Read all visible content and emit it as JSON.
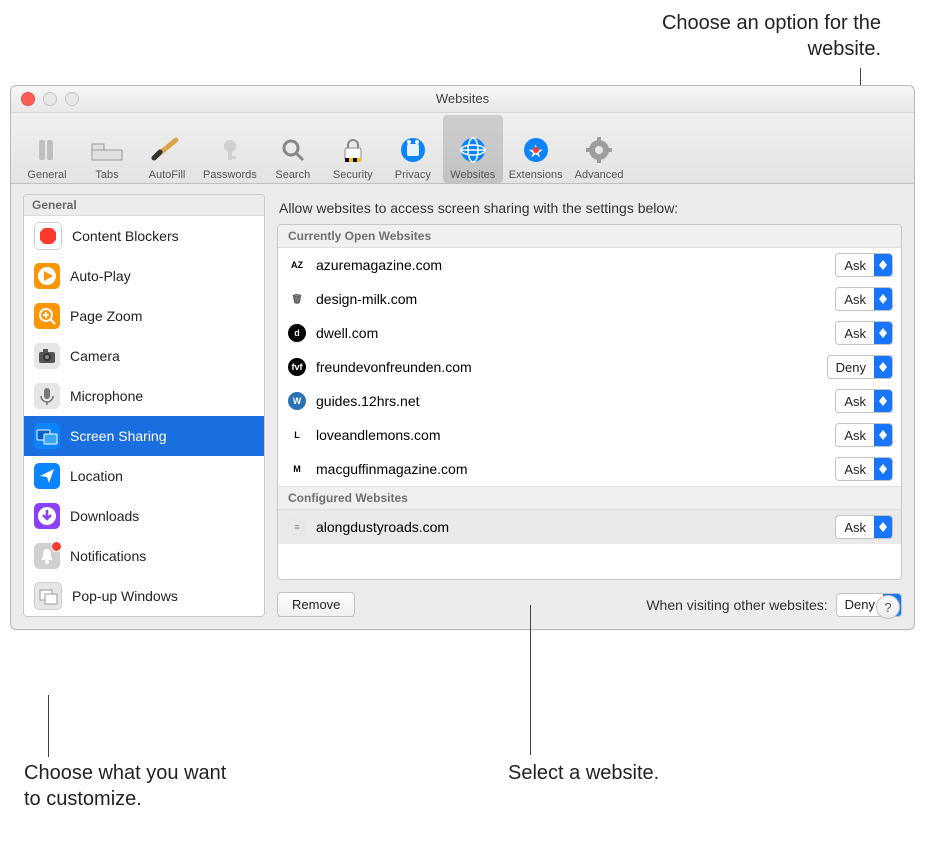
{
  "callouts": {
    "top": "Choose an option for the website.",
    "bottomLeft": "Choose what you want to customize.",
    "bottomRight": "Select a website."
  },
  "window": {
    "title": "Websites"
  },
  "toolbar": {
    "items": [
      {
        "label": "General"
      },
      {
        "label": "Tabs"
      },
      {
        "label": "AutoFill"
      },
      {
        "label": "Passwords"
      },
      {
        "label": "Search"
      },
      {
        "label": "Security"
      },
      {
        "label": "Privacy"
      },
      {
        "label": "Websites"
      },
      {
        "label": "Extensions"
      },
      {
        "label": "Advanced"
      }
    ],
    "selected": "Websites"
  },
  "sidebar": {
    "header": "General",
    "items": [
      {
        "label": "Content Blockers",
        "icon": "stop",
        "bg": "#ffffff",
        "badge": false
      },
      {
        "label": "Auto-Play",
        "icon": "play",
        "bg": "#ff9500",
        "badge": false
      },
      {
        "label": "Page Zoom",
        "icon": "zoom",
        "bg": "#ff9500",
        "badge": false
      },
      {
        "label": "Camera",
        "icon": "camera",
        "bg": "#7a7a7a",
        "badge": false
      },
      {
        "label": "Microphone",
        "icon": "mic",
        "bg": "#c9c9c9",
        "badge": false
      },
      {
        "label": "Screen Sharing",
        "icon": "screens",
        "bg": "#0a84ff",
        "badge": false
      },
      {
        "label": "Location",
        "icon": "arrow",
        "bg": "#0a84ff",
        "badge": false
      },
      {
        "label": "Downloads",
        "icon": "download",
        "bg": "#8d3fff",
        "badge": false
      },
      {
        "label": "Notifications",
        "icon": "bell",
        "bg": "#d0d0d0",
        "badge": true
      },
      {
        "label": "Pop-up Windows",
        "icon": "popup",
        "bg": "#ffffff",
        "badge": false
      }
    ],
    "selected": "Screen Sharing"
  },
  "main": {
    "heading": "Allow websites to access screen sharing with the settings below:",
    "sections": {
      "open_header": "Currently Open Websites",
      "configured_header": "Configured Websites"
    },
    "open": [
      {
        "domain": "azuremagazine.com",
        "value": "Ask",
        "fav": "AZ",
        "favbg": "#fff",
        "favcolor": "#000"
      },
      {
        "domain": "design-milk.com",
        "value": "Ask",
        "fav": "🗑",
        "favbg": "#fff",
        "favcolor": "#555"
      },
      {
        "domain": "dwell.com",
        "value": "Ask",
        "fav": "d",
        "favbg": "#000",
        "favcolor": "#fff"
      },
      {
        "domain": "freundevonfreunden.com",
        "value": "Deny",
        "fav": "fvf",
        "favbg": "#000",
        "favcolor": "#fff"
      },
      {
        "domain": "guides.12hrs.net",
        "value": "Ask",
        "fav": "W",
        "favbg": "#2a71b8",
        "favcolor": "#fff"
      },
      {
        "domain": "loveandlemons.com",
        "value": "Ask",
        "fav": "L",
        "favbg": "#fff",
        "favcolor": "#000"
      },
      {
        "domain": "macguffinmagazine.com",
        "value": "Ask",
        "fav": "M",
        "favbg": "#fff",
        "favcolor": "#000"
      }
    ],
    "configured": [
      {
        "domain": "alongdustyroads.com",
        "value": "Ask",
        "fav": "≡",
        "favbg": "#e8e8e8",
        "favcolor": "#888"
      }
    ],
    "remove_label": "Remove",
    "other_label": "When visiting other websites:",
    "other_value": "Deny"
  },
  "help": "?"
}
